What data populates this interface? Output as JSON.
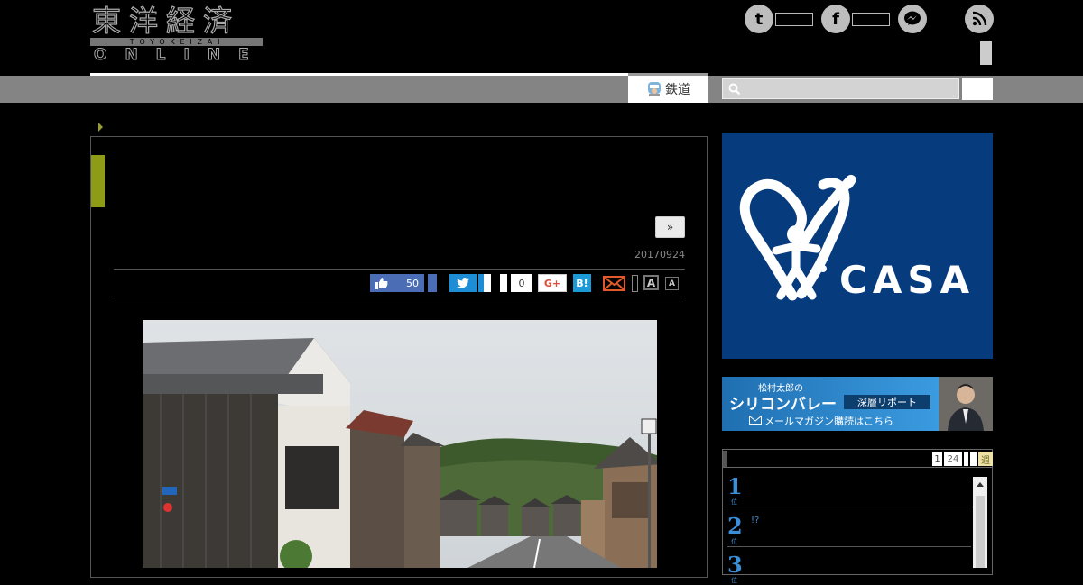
{
  "logo": {
    "kanji": "東洋経済",
    "roman": "TOYOKEIZAI",
    "online": "ONLINE"
  },
  "share_top": {
    "twitter_glyph": "t",
    "facebook_glyph": "f",
    "icons": [
      "twitter-icon",
      "facebook-icon",
      "messenger-icon",
      "rss-icon"
    ]
  },
  "nav": {
    "active_tab": "鉄道"
  },
  "article": {
    "next_label": "»",
    "date": "20170924",
    "like_count": "50",
    "comment_count": "0",
    "gplus_label": "G+",
    "hatena_label": "B!",
    "font_large": "A",
    "font_small": "A"
  },
  "sidebar": {
    "ad_brand": "CASA",
    "banner": {
      "line1": "松村太郎の",
      "line2": "シリコンバレー",
      "line3": "深層リポート",
      "line4": "メールマガジン購読はこちら"
    },
    "ranking": {
      "tabs": [
        "1",
        "24",
        "",
        "",
        "週"
      ],
      "items": [
        {
          "rank": "1",
          "suffix": "位",
          "title": ""
        },
        {
          "rank": "2",
          "suffix": "位",
          "title": "!?"
        },
        {
          "rank": "3",
          "suffix": "位",
          "title": ""
        }
      ]
    }
  },
  "colors": {
    "accent": "#8d9b17",
    "nav_bar": "#848484",
    "casa_blue": "#063b7e",
    "rank_blue": "#3a8fd8",
    "twitter": "#1d8ed6",
    "facebook": "#3b5998"
  }
}
